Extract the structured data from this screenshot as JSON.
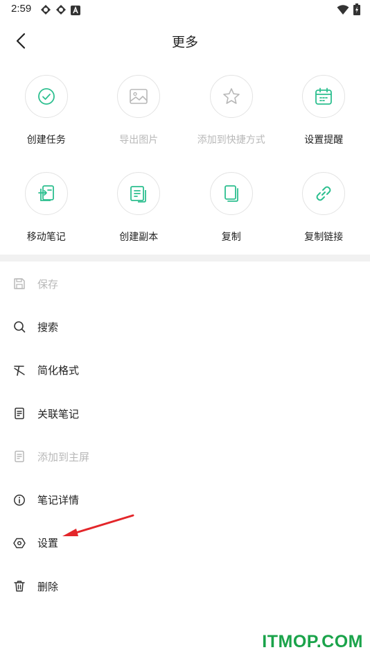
{
  "status_bar": {
    "time": "2:59"
  },
  "header": {
    "title": "更多"
  },
  "grid": {
    "items": [
      {
        "label": "创建任务",
        "icon": "check-circle-icon",
        "enabled": true
      },
      {
        "label": "导出图片",
        "icon": "image-icon",
        "enabled": false
      },
      {
        "label": "添加到快捷方式",
        "icon": "star-icon",
        "enabled": false
      },
      {
        "label": "设置提醒",
        "icon": "calendar-icon",
        "enabled": true
      },
      {
        "label": "移动笔记",
        "icon": "move-note-icon",
        "enabled": true
      },
      {
        "label": "创建副本",
        "icon": "duplicate-icon",
        "enabled": true
      },
      {
        "label": "复制",
        "icon": "copy-icon",
        "enabled": true
      },
      {
        "label": "复制链接",
        "icon": "link-icon",
        "enabled": true
      }
    ]
  },
  "menu": {
    "items": [
      {
        "label": "保存",
        "icon": "save-icon",
        "enabled": false
      },
      {
        "label": "搜索",
        "icon": "search-icon",
        "enabled": true
      },
      {
        "label": "简化格式",
        "icon": "clear-format-icon",
        "enabled": true
      },
      {
        "label": "关联笔记",
        "icon": "linked-note-icon",
        "enabled": true
      },
      {
        "label": "添加到主屏",
        "icon": "home-screen-icon",
        "enabled": false
      },
      {
        "label": "笔记详情",
        "icon": "info-icon",
        "enabled": true
      },
      {
        "label": "设置",
        "icon": "settings-icon",
        "enabled": true
      },
      {
        "label": "删除",
        "icon": "trash-icon",
        "enabled": true
      }
    ]
  },
  "colors": {
    "accent": "#2cbf8f",
    "disabled": "#b8b8b8",
    "annotation": "#e3262a",
    "watermark": "#1aa34a"
  },
  "watermark": "ITMOP.COM"
}
